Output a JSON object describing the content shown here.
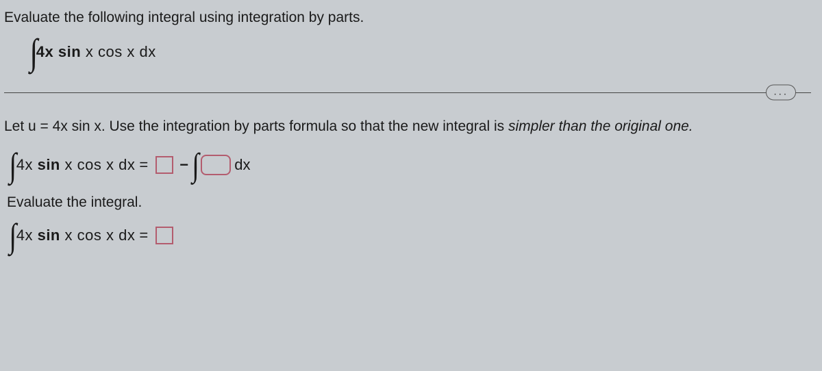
{
  "prompt": "Evaluate the following integral using integration by parts.",
  "integral_expr": "4x sin x cos x dx",
  "ellipsis": "...",
  "instruction_prefix": "Let u = 4x sin x. Use the integration by parts formula so that the new integral is ",
  "instruction_em": "simpler than the original one.",
  "eq1": {
    "lhs": "4x sin x cos x dx",
    "equals": "=",
    "minus": "−",
    "trail": " dx"
  },
  "evaluate_label": "Evaluate the integral.",
  "eq2": {
    "lhs": "4x sin x cos x dx",
    "equals": "="
  }
}
